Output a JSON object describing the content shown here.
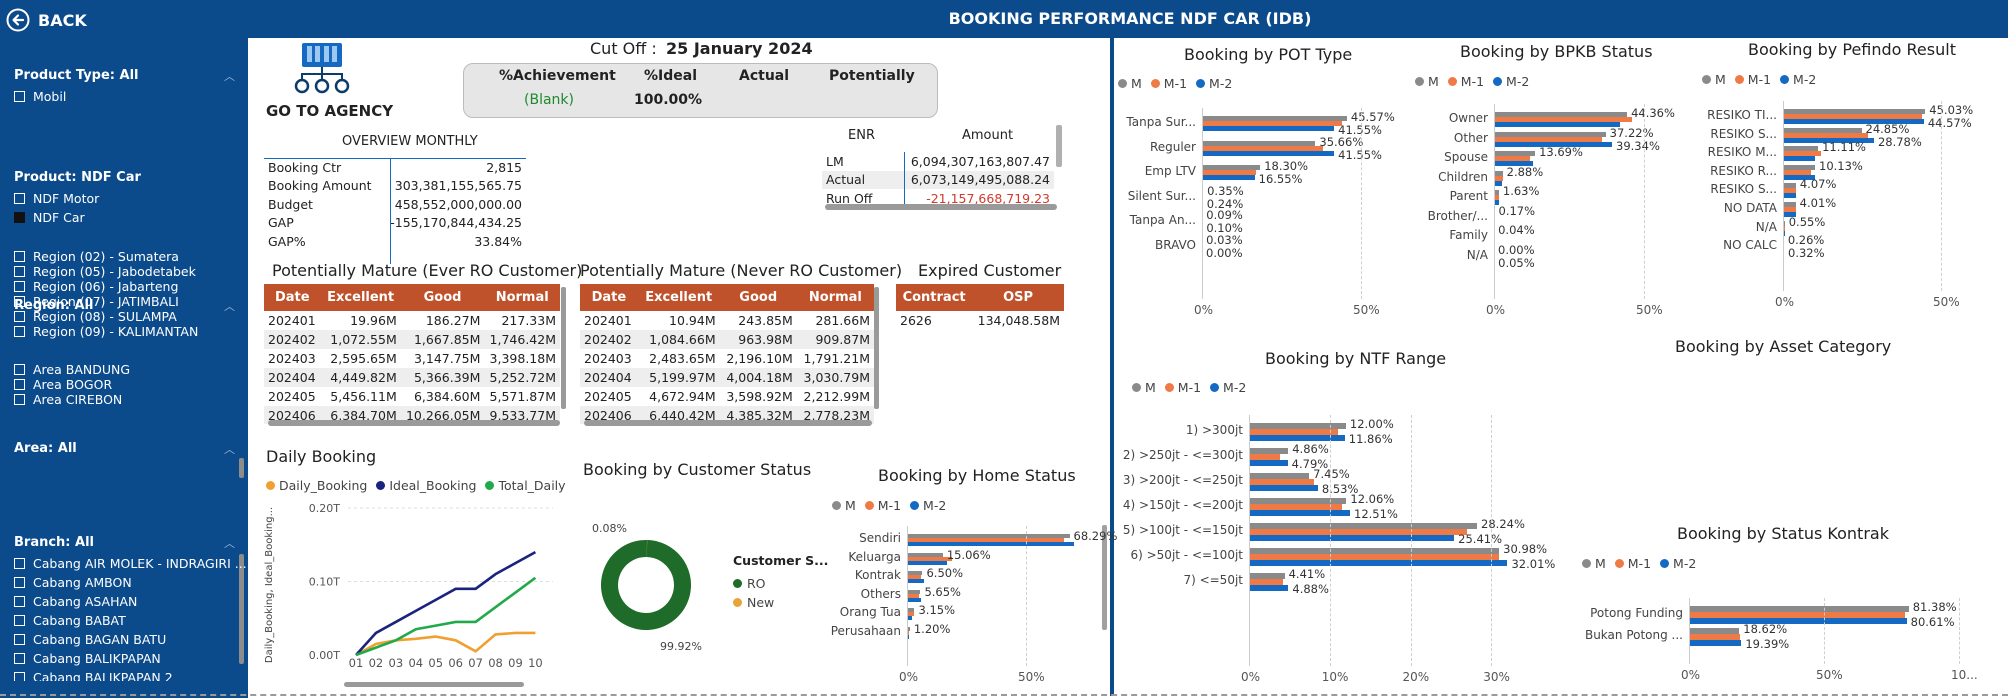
{
  "header": {
    "back_label": "BACK",
    "title": "BOOKING PERFORMANCE NDF CAR (IDB)"
  },
  "colors": {
    "navy": "#0b4a8b",
    "grey": "#8a8a8a",
    "orange": "#ef7a45",
    "blue": "#1469c2",
    "table_header": "#c0522b"
  },
  "sidebar": {
    "product_type": {
      "title": "Product Type: All",
      "items": [
        "Mobil"
      ]
    },
    "product": {
      "title": "Product: NDF Car",
      "items": [
        {
          "label": "NDF Motor",
          "checked": false
        },
        {
          "label": "NDF Car",
          "checked": true
        }
      ]
    },
    "region": {
      "title": "Region: All",
      "items": [
        "Region (02) - Sumatera",
        "Region (05) - Jabodetabek",
        "Region (06) - Jabarteng",
        "Region (07) - JATIMBALI",
        "Region (08) - SULAMPA",
        "Region (09) - KALIMANTAN"
      ]
    },
    "area": {
      "title": "Area: All",
      "items": [
        "Area BANDUNG",
        "Area BOGOR",
        "Area CIREBON"
      ]
    },
    "branch": {
      "title": "Branch: All",
      "items": [
        "Cabang AIR MOLEK - INDRAGIRI ...",
        "Cabang AMBON",
        "Cabang ASAHAN",
        "Cabang BABAT",
        "Cabang BAGAN BATU",
        "Cabang BALIKPAPAN",
        "Cabang BALIKPAPAN 2"
      ]
    }
  },
  "agency": {
    "label": "GO TO AGENCY",
    "icon": "agency-network-icon"
  },
  "cutoff": {
    "label": "Cut Off :",
    "date": "25 January 2024"
  },
  "achievement": {
    "headers": [
      "%Achievement",
      "%Ideal",
      "Actual",
      "Potentially"
    ],
    "values": [
      "(Blank)",
      "100.00%",
      "",
      ""
    ]
  },
  "overview": {
    "title": "OVERVIEW MONTHLY",
    "rows": [
      [
        "Booking Ctr",
        "2,815"
      ],
      [
        "Booking Amount",
        "303,381,155,565.75"
      ],
      [
        "Budget",
        "458,552,000,000.00"
      ],
      [
        "GAP",
        "-155,170,844,434.25"
      ],
      [
        "GAP%",
        "33.84%"
      ]
    ]
  },
  "enr": {
    "headers": [
      "ENR",
      "Amount"
    ],
    "rows": [
      [
        "LM",
        "6,094,307,163,807.47"
      ],
      [
        "Actual",
        "6,073,149,495,088.24"
      ],
      [
        "Run Off",
        "-21,157,668,719.23"
      ]
    ]
  },
  "mature_ever": {
    "title": "Potentially Mature (Ever RO Customer)",
    "headers": [
      "Date",
      "Excellent",
      "Good",
      "Normal"
    ],
    "rows": [
      [
        "202401",
        "19.96M",
        "186.27M",
        "217.33M"
      ],
      [
        "202402",
        "1,072.55M",
        "1,667.85M",
        "1,746.42M"
      ],
      [
        "202403",
        "2,595.65M",
        "3,147.75M",
        "3,398.18M"
      ],
      [
        "202404",
        "4,449.82M",
        "5,366.39M",
        "5,252.72M"
      ],
      [
        "202405",
        "5,456.11M",
        "6,384.60M",
        "5,571.87M"
      ],
      [
        "202406",
        "6,384.70M",
        "10,266.05M",
        "9,533.77M"
      ]
    ]
  },
  "mature_never": {
    "title": "Potentially Mature (Never RO Customer)",
    "headers": [
      "Date",
      "Excellent",
      "Good",
      "Normal"
    ],
    "rows": [
      [
        "202401",
        "10.94M",
        "243.85M",
        "281.66M"
      ],
      [
        "202402",
        "1,084.66M",
        "963.98M",
        "909.87M"
      ],
      [
        "202403",
        "2,483.65M",
        "2,196.10M",
        "1,791.21M"
      ],
      [
        "202404",
        "5,199.97M",
        "4,004.18M",
        "3,030.79M"
      ],
      [
        "202405",
        "4,672.94M",
        "3,598.92M",
        "2,212.99M"
      ],
      [
        "202406",
        "6,440.42M",
        "4,385.32M",
        "2,778.23M"
      ]
    ]
  },
  "expired": {
    "title": "Expired Customer",
    "headers": [
      "Contract",
      "OSP"
    ],
    "rows": [
      [
        "2626",
        "134,048.58M"
      ]
    ]
  },
  "series_names": [
    "M",
    "M-1",
    "M-2"
  ],
  "chart_data": [
    {
      "id": "daily",
      "type": "line",
      "title": "Daily Booking",
      "ylabel": "Daily_Booking, Ideal_Booking...",
      "ylim": [
        0,
        0.2
      ],
      "yticks": [
        "0.00T",
        "0.10T",
        "0.20T"
      ],
      "categories": [
        "01",
        "02",
        "03",
        "04",
        "05",
        "06",
        "07",
        "08",
        "09",
        "10"
      ],
      "series": [
        {
          "name": "Daily_Booking",
          "color": "#f0a030",
          "values": [
            0,
            0.015,
            0.02,
            0.022,
            0.025,
            0.02,
            0.005,
            0.028,
            0.03,
            0.03
          ]
        },
        {
          "name": "Ideal_Booking",
          "color": "#1a237e",
          "values": [
            0,
            0.03,
            0.045,
            0.06,
            0.075,
            0.09,
            0.09,
            0.11,
            0.125,
            0.14
          ]
        },
        {
          "name": "Total_Daily",
          "color": "#22aa4a",
          "values": [
            0,
            0.01,
            0.02,
            0.035,
            0.04,
            0.045,
            0.045,
            0.065,
            0.085,
            0.105
          ]
        }
      ]
    },
    {
      "id": "customer",
      "type": "pie",
      "title": "Booking by Customer Status",
      "legend_title": "Customer S...",
      "series": [
        {
          "name": "RO",
          "value": 99.92,
          "label": "99.92%",
          "color": "#1e6b2a"
        },
        {
          "name": "New",
          "value": 0.08,
          "label": "0.08%",
          "color": "#e8a33a"
        }
      ]
    },
    {
      "id": "home",
      "type": "bar",
      "title": "Booking by Home Status",
      "xlim": [
        0,
        100
      ],
      "xticks": [
        "0%",
        "50%"
      ],
      "categories": [
        "Sendiri",
        "Keluarga",
        "Kontrak",
        "Others",
        "Orang Tua",
        "Perusahaan"
      ],
      "labels": [
        "68.29%",
        "15.06%",
        "6.50%",
        "5.65%",
        "3.15%",
        "1.20%"
      ],
      "series": [
        {
          "name": "M",
          "values": [
            68.29,
            15.06,
            6.5,
            5.65,
            3.15,
            1.2
          ]
        },
        {
          "name": "M-1",
          "values": [
            66,
            19,
            6,
            5,
            3,
            1
          ]
        },
        {
          "name": "M-2",
          "values": [
            70,
            17,
            7,
            6,
            2,
            1
          ]
        }
      ]
    },
    {
      "id": "pot",
      "type": "bar",
      "title": "Booking by POT Type",
      "xlim": [
        0,
        100
      ],
      "xticks": [
        "0%",
        "50%"
      ],
      "categories": [
        "Tanpa Sur...",
        "Reguler",
        "Emp LTV",
        "Silent Sur...",
        "Tanpa An...",
        "BRAVO"
      ],
      "labels": [
        [
          "45.57%",
          "41.55%"
        ],
        [
          "35.66%",
          "41.55%"
        ],
        [
          "18.30%",
          "16.55%"
        ],
        [
          "0.35%",
          "0.24%"
        ],
        [
          "0.09%",
          "0.10%"
        ],
        [
          "0.03%",
          "0.00%"
        ]
      ],
      "series": [
        {
          "name": "M",
          "values": [
            45.57,
            35.66,
            18.3,
            0.35,
            0.09,
            0.03
          ]
        },
        {
          "name": "M-1",
          "values": [
            44,
            38,
            17,
            0.3,
            0.1,
            0
          ]
        },
        {
          "name": "M-2",
          "values": [
            41.55,
            41.55,
            16.55,
            0.24,
            0.1,
            0
          ]
        }
      ]
    },
    {
      "id": "bpkb",
      "type": "bar",
      "title": "Booking by BPKB Status",
      "xlim": [
        0,
        100
      ],
      "xticks": [
        "0%",
        "50%"
      ],
      "categories": [
        "Owner",
        "Other",
        "Spouse",
        "Children",
        "Parent",
        "Brother/...",
        "Family",
        "N/A"
      ],
      "labels": [
        [
          "44.36%",
          ""
        ],
        [
          "37.22%",
          "39.34%"
        ],
        [
          "13.69%",
          ""
        ],
        [
          "2.88%",
          ""
        ],
        [
          "1.63%",
          ""
        ],
        [
          "0.17%",
          ""
        ],
        [
          "0.04%",
          ""
        ],
        [
          "0.00%",
          "0.05%"
        ]
      ],
      "series": [
        {
          "name": "M",
          "values": [
            44.36,
            37.22,
            13.69,
            2.88,
            1.63,
            0.17,
            0.04,
            0
          ]
        },
        {
          "name": "M-1",
          "values": [
            46,
            36,
            12,
            3,
            1.5,
            0.2,
            0,
            0
          ]
        },
        {
          "name": "M-2",
          "values": [
            42,
            39.34,
            13,
            2.5,
            1.7,
            0.2,
            0,
            0.05
          ]
        }
      ]
    },
    {
      "id": "pefindo",
      "type": "bar",
      "title": "Booking by Pefindo Result",
      "xlim": [
        0,
        100
      ],
      "xticks": [
        "0%",
        "50%"
      ],
      "categories": [
        "RESIKO TI...",
        "RESIKO S...",
        "RESIKO M...",
        "RESIKO R...",
        "RESIKO S...",
        "NO DATA",
        "N/A",
        "NO CALC"
      ],
      "labels": [
        [
          "45.03%",
          "44.57%"
        ],
        [
          "24.85%",
          "28.78%"
        ],
        [
          "11.11%",
          ""
        ],
        [
          "10.13%",
          ""
        ],
        [
          "4.07%",
          ""
        ],
        [
          "4.01%",
          ""
        ],
        [
          "0.55%",
          ""
        ],
        [
          "0.26%",
          "0.32%"
        ]
      ],
      "series": [
        {
          "name": "M",
          "values": [
            45.03,
            24.85,
            11.11,
            10.13,
            4.07,
            4.01,
            0.55,
            0.26
          ]
        },
        {
          "name": "M-1",
          "values": [
            44,
            27,
            12,
            9,
            4,
            4,
            0.5,
            0.3
          ]
        },
        {
          "name": "M-2",
          "values": [
            44.57,
            28.78,
            10,
            10,
            4,
            4,
            0.5,
            0.32
          ]
        }
      ]
    },
    {
      "id": "ntf",
      "type": "bar",
      "title": "Booking by NTF Range",
      "xlim": [
        0,
        40
      ],
      "xticks": [
        "0%",
        "10%",
        "20%",
        "30%"
      ],
      "categories": [
        "1) >300jt",
        "2) >250jt - <=300jt",
        "3) >200jt - <=250jt",
        "4) >150jt - <=200jt",
        "5) >100jt - <=150jt",
        "6) >50jt - <=100jt",
        "7) <=50jt"
      ],
      "labels": [
        [
          "12.00%",
          "11.86%"
        ],
        [
          "4.86%",
          "4.79%"
        ],
        [
          "7.45%",
          "8.53%"
        ],
        [
          "12.06%",
          "12.51%"
        ],
        [
          "28.24%",
          "25.41%"
        ],
        [
          "30.98%",
          "32.01%"
        ],
        [
          "4.41%",
          "4.88%"
        ]
      ],
      "series": [
        {
          "name": "M",
          "values": [
            12,
            4.86,
            7.45,
            12.06,
            28.24,
            30.98,
            4.41
          ]
        },
        {
          "name": "M-1",
          "values": [
            11,
            3.8,
            8,
            11.5,
            27,
            31,
            4.2
          ]
        },
        {
          "name": "M-2",
          "values": [
            11.86,
            4.79,
            8.53,
            12.51,
            25.41,
            32.01,
            4.88
          ]
        }
      ]
    },
    {
      "id": "asset",
      "type": "bar",
      "title": "Booking by Asset Category",
      "categories": [],
      "series": []
    },
    {
      "id": "kontrak",
      "type": "bar",
      "title": "Booking by Status Kontrak",
      "xlim": [
        0,
        100
      ],
      "xticks": [
        "0%",
        "50%",
        "10..."
      ],
      "categories": [
        "Potong Funding",
        "Bukan Potong ..."
      ],
      "labels": [
        [
          "81.38%",
          "80.61%"
        ],
        [
          "18.62%",
          "19.39%"
        ]
      ],
      "series": [
        {
          "name": "M",
          "values": [
            81.38,
            18.62
          ]
        },
        {
          "name": "M-1",
          "values": [
            80,
            19
          ]
        },
        {
          "name": "M-2",
          "values": [
            80.61,
            19.39
          ]
        }
      ]
    }
  ]
}
